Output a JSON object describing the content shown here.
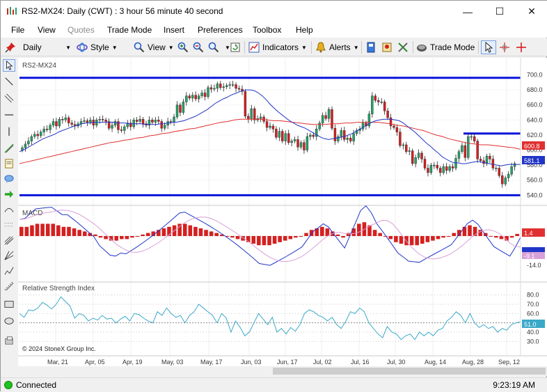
{
  "window": {
    "title": "RS2-MX24: Daily (CWT) : 3 hour 56 minute 40 second",
    "min_glyph": "—",
    "max_glyph": "☐",
    "close_glyph": "✕"
  },
  "menu": [
    "File",
    "View",
    "Quotes",
    "Trade Mode",
    "Insert",
    "Preferences",
    "Toolbox",
    "Help"
  ],
  "menu_disabled": [
    "Quotes"
  ],
  "toolbar": {
    "interval": "Daily",
    "style": "Style",
    "view": "View",
    "indicators": "Indicators",
    "alerts": "Alerts",
    "trade_mode": "Trade Mode"
  },
  "chart": {
    "symbol_label": "RS2-MX24",
    "macd_label": "MACD",
    "rsi_label": "Relative Strength Index",
    "copyright": "© 2024 StoneX Group Inc.",
    "price_axis": [
      "700.0",
      "680.0",
      "660.0",
      "640.0",
      "620.0",
      "600.0",
      "580.0",
      "560.0",
      "540.0"
    ],
    "price_badges": {
      "red_ma": "600.8",
      "last": "581.1"
    },
    "macd_axis": [
      "-14.0"
    ],
    "macd_badges": {
      "hist": "1.4",
      "macd": "-5.5",
      "signal": "-9.1"
    },
    "rsi_axis": [
      "80.0",
      "70.0",
      "60.0",
      "50.0",
      "40.0",
      "30.0"
    ],
    "rsi_badge": "51.0",
    "date_axis": [
      "Mar, 21",
      "Apr, 05",
      "Apr, 19",
      "May, 03",
      "May, 17",
      "Jun, 03",
      "Jun, 17",
      "Jul, 02",
      "Jul, 16",
      "Jul, 30",
      "Aug, 14",
      "Aug, 28",
      "Sep, 12"
    ],
    "hlines": [
      696,
      540,
      622
    ],
    "colors": {
      "up": "#26a26a",
      "down": "#d42020",
      "blue": "#2035c8",
      "red": "#e03030",
      "pink": "#d8a0d8",
      "hline": "#0a14d8"
    }
  },
  "chart_data": {
    "type": "candlestick",
    "ylim": [
      532,
      706
    ],
    "closes": [
      603,
      608,
      612,
      618,
      621,
      619,
      624,
      628,
      627,
      633,
      638,
      632,
      641,
      640,
      643,
      636,
      634,
      632,
      635,
      638,
      639,
      637,
      640,
      633,
      640,
      641,
      640,
      638,
      629,
      633,
      638,
      627,
      626,
      631,
      636,
      631,
      640,
      638,
      641,
      635,
      633,
      640,
      637,
      640,
      638,
      629,
      633,
      638,
      637,
      644,
      660,
      650,
      664,
      672,
      669,
      673,
      668,
      672,
      676,
      671,
      683,
      681,
      682,
      688,
      683,
      684,
      686,
      687,
      687,
      682,
      681,
      678,
      645,
      641,
      655,
      640,
      642,
      644,
      638,
      630,
      632,
      628,
      617,
      625,
      612,
      622,
      610,
      612,
      614,
      604,
      610,
      600,
      618,
      620,
      618,
      628,
      636,
      646,
      642,
      654,
      629,
      612,
      618,
      626,
      614,
      616,
      612,
      622,
      626,
      628,
      636,
      632,
      648,
      672,
      666,
      664,
      664,
      652,
      643,
      632,
      630,
      624,
      606,
      607,
      598,
      599,
      582,
      590,
      596,
      588,
      576,
      570,
      580,
      580,
      576,
      570,
      578,
      573,
      578,
      576,
      589,
      598,
      606,
      590,
      618,
      618,
      612,
      588,
      586,
      582,
      592,
      588,
      576,
      576,
      566,
      555,
      563,
      568,
      578,
      582
    ],
    "ma_blue": [
      598,
      600,
      603,
      606,
      609,
      612,
      615,
      617,
      619,
      621,
      624,
      626,
      628,
      630,
      632,
      633,
      635,
      636,
      636,
      637,
      637,
      637,
      637,
      637,
      637,
      636,
      636,
      636,
      635,
      635,
      635,
      635,
      634,
      634,
      634,
      634,
      635,
      635,
      636,
      637,
      637,
      638,
      639,
      641,
      643,
      645,
      648,
      651,
      654,
      658,
      662,
      665,
      668,
      670,
      673,
      675,
      677,
      679,
      680,
      680,
      679,
      676,
      672,
      667,
      661,
      656,
      651,
      647,
      643,
      639,
      636,
      633,
      631,
      629,
      626,
      623,
      620,
      617,
      615,
      614,
      615,
      616,
      617,
      618,
      620,
      622,
      625,
      628,
      631,
      634,
      637,
      639,
      640,
      641,
      641,
      641,
      640,
      639,
      636,
      632,
      628,
      624,
      619,
      614,
      609,
      605,
      600,
      596,
      591,
      588,
      585,
      583,
      583,
      582,
      582,
      583,
      584,
      585,
      584,
      583,
      582,
      581,
      580,
      579,
      580,
      581,
      581,
      581,
      581
    ],
    "ma_red": [
      582,
      584,
      586,
      588,
      590,
      592,
      594,
      596,
      598,
      600,
      602,
      604,
      606,
      608,
      610,
      611,
      613,
      614,
      616,
      617,
      619,
      620,
      622,
      623,
      625,
      626,
      628,
      629,
      631,
      633,
      635,
      637,
      638,
      640,
      641,
      641,
      641,
      641,
      640,
      639,
      639,
      638,
      637,
      636,
      635,
      634,
      634,
      634,
      635,
      635,
      636,
      636,
      637,
      637,
      637,
      637,
      636,
      635,
      633,
      632,
      630,
      628,
      626,
      623,
      620,
      618,
      615,
      613,
      611,
      609,
      608,
      607,
      607,
      606,
      605,
      604,
      603,
      601
    ],
    "macd_hist": [
      6,
      6,
      7,
      8,
      8,
      8,
      8,
      7,
      6,
      6,
      5,
      4,
      3,
      2,
      1,
      -1,
      -2,
      -3,
      -3,
      -2,
      -2,
      -1,
      0,
      1,
      2,
      3,
      4,
      5,
      6,
      7,
      8,
      8,
      7,
      6,
      5,
      4,
      3,
      2,
      1,
      0,
      -1,
      -2,
      -3,
      -4,
      -5,
      -6,
      -6,
      -6,
      -5,
      -4,
      -3,
      -2,
      -1,
      0,
      2,
      4,
      5,
      6,
      5,
      3,
      1,
      -1,
      2,
      5,
      8,
      9,
      7,
      4,
      2,
      0,
      -2,
      -4,
      -5,
      -6,
      -6,
      -6,
      -5,
      -4,
      -3,
      -2,
      -1,
      0,
      2,
      4,
      6,
      7,
      6,
      4,
      2,
      0,
      -1,
      -2,
      -3,
      -1,
      1.4
    ],
    "rsi": [
      60,
      56,
      64,
      63,
      66,
      72,
      69,
      65,
      70,
      78,
      73,
      68,
      55,
      60,
      58,
      52,
      55,
      53,
      58,
      54,
      55,
      50,
      54,
      57,
      52,
      60,
      59,
      55,
      52,
      50,
      62,
      58,
      66,
      60,
      56,
      58,
      50,
      58,
      62,
      70,
      66,
      62,
      58,
      50,
      60,
      55,
      40,
      52,
      45,
      36,
      40,
      50,
      60,
      54,
      48,
      56,
      40,
      44,
      38,
      45,
      41,
      48,
      60,
      64,
      62,
      58,
      56,
      52,
      56,
      48,
      44,
      52,
      62,
      60,
      66,
      62,
      50,
      44,
      38,
      34,
      46,
      40,
      38,
      32,
      36,
      38,
      32,
      40,
      36,
      40,
      36,
      42,
      44,
      52,
      56,
      62,
      58,
      50,
      60,
      50,
      45,
      48,
      44,
      46,
      40,
      44,
      42,
      48,
      50,
      51
    ]
  }
}
